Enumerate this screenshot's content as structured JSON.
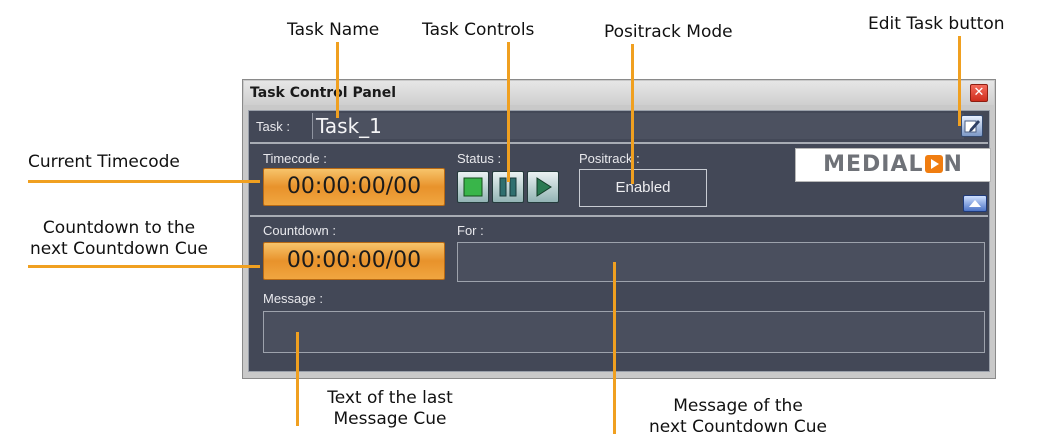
{
  "annotations": {
    "task_name": "Task Name",
    "task_controls": "Task Controls",
    "positrack_mode": "Positrack Mode",
    "edit_task_button": "Edit Task button",
    "current_timecode": "Current Timecode",
    "countdown_line1": "Countdown to the",
    "countdown_line2": "next Countdown Cue",
    "last_message_line1": "Text of the last",
    "last_message_line2": "Message Cue",
    "next_message_line1": "Message of the",
    "next_message_line2": "next Countdown Cue"
  },
  "window": {
    "title": "Task Control Panel",
    "close_glyph": "✕"
  },
  "task": {
    "label": "Task :",
    "name": "Task_1"
  },
  "timecode": {
    "label": "Timecode :",
    "value": "00:00:00/00"
  },
  "status": {
    "label": "Status :",
    "controls": [
      "stop-icon",
      "pause-icon",
      "play-icon"
    ]
  },
  "positrack": {
    "label": "Positrack :",
    "value": "Enabled"
  },
  "logo": {
    "text_a": "MEDIAL",
    "text_b": "N",
    "accent": "#f07d10"
  },
  "countdown": {
    "label": "Countdown :",
    "value": "00:00:00/00"
  },
  "for": {
    "label": "For :",
    "value": ""
  },
  "message": {
    "label": "Message :",
    "value": ""
  },
  "colors": {
    "panel_bg": "#434857",
    "timecode_orange": "#e8922b",
    "callout_line": "#f0a020"
  }
}
